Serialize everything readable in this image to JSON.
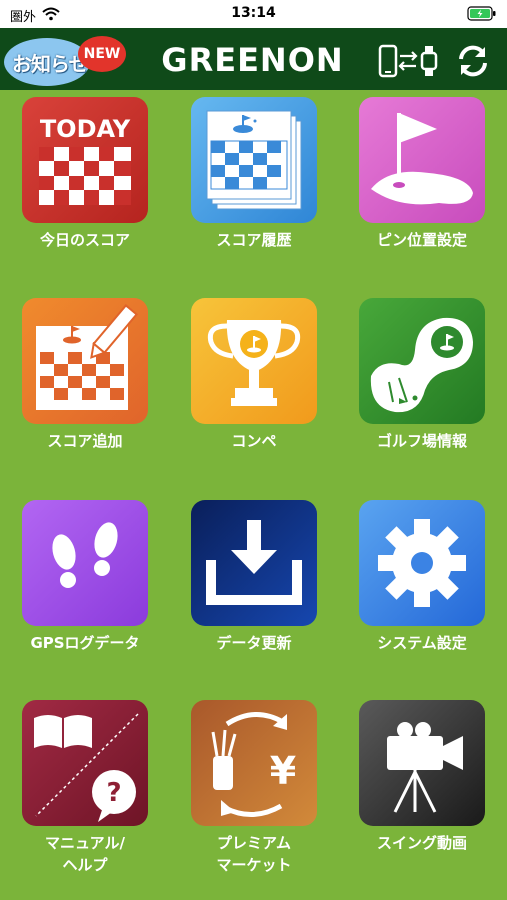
{
  "status_bar": {
    "carrier": "圏外",
    "time": "13:14"
  },
  "header": {
    "news_label": "お知らせ",
    "news_badge": "NEW",
    "logo": "GREENON",
    "icons": [
      "phone-watch-sync-icon",
      "refresh-icon"
    ]
  },
  "menu": [
    {
      "label": "今日のスコア",
      "icon": "today-scorecard-icon",
      "color": "#c9302c",
      "today_text": "TODAY"
    },
    {
      "label": "スコア履歴",
      "icon": "score-history-icon",
      "color": "#4aa3e8"
    },
    {
      "label": "ピン位置設定",
      "icon": "pin-flag-icon",
      "color": "#d95fc4"
    },
    {
      "label": "スコア追加",
      "icon": "add-score-icon",
      "color": "#ef7a2a"
    },
    {
      "label": "コンペ",
      "icon": "trophy-icon",
      "color": "#f5b21a"
    },
    {
      "label": "ゴルフ場情報",
      "icon": "course-map-icon",
      "color": "#2e8a2e"
    },
    {
      "label": "GPSログデータ",
      "icon": "footprints-icon",
      "color": "#a547e6"
    },
    {
      "label": "データ更新",
      "icon": "download-icon",
      "color": "#0b2a74"
    },
    {
      "label": "システム設定",
      "icon": "gear-icon",
      "color": "#2f7fe0"
    },
    {
      "label": "マニュアル/\nヘルプ",
      "label_lines": [
        "マニュアル/",
        "ヘルプ"
      ],
      "icon": "manual-help-icon",
      "color": "#8e1f34"
    },
    {
      "label_lines": [
        "プレミアム",
        "マーケット"
      ],
      "icon": "premium-market-icon",
      "color": "#c47a2a",
      "currency": "¥"
    },
    {
      "label": "スイング動画",
      "icon": "video-camera-icon",
      "color": "#333333"
    }
  ]
}
